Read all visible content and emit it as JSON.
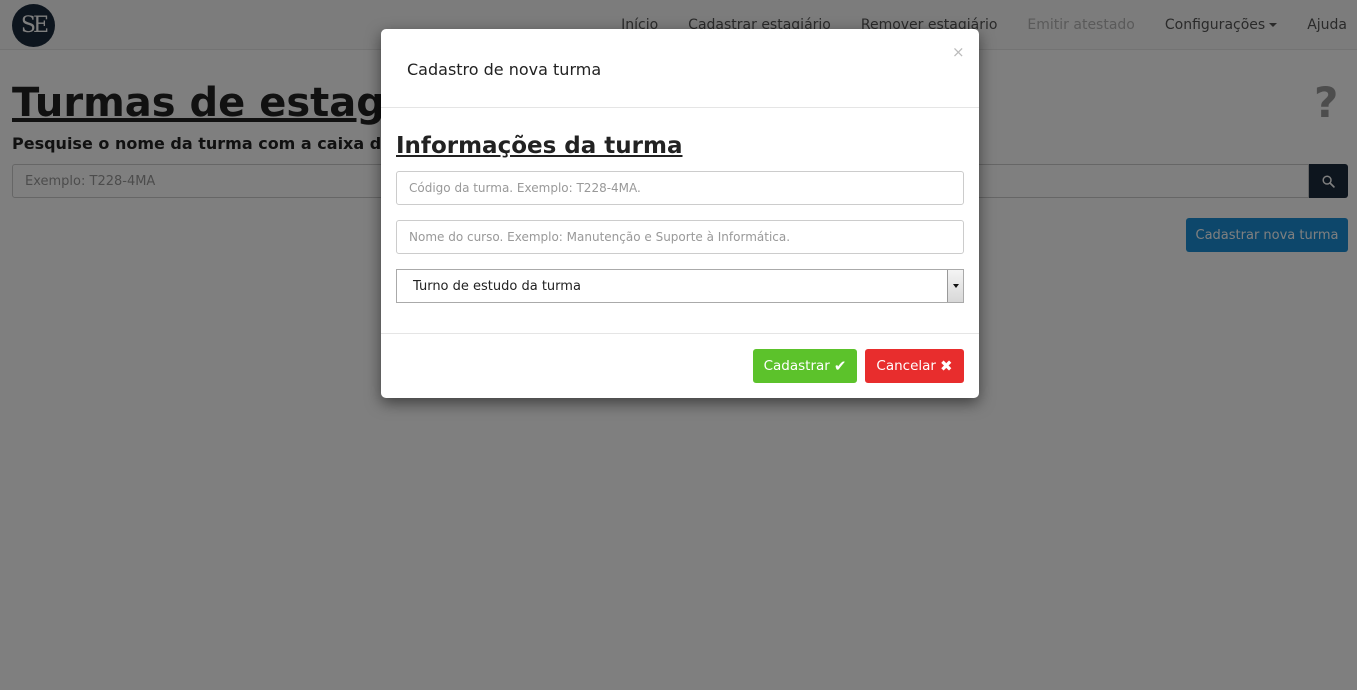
{
  "app": {
    "logo_text": "SE"
  },
  "nav": {
    "items": [
      {
        "label": "Início"
      },
      {
        "label": "Cadastrar estagiário"
      },
      {
        "label": "Remover estagiário"
      },
      {
        "label": "Emitir atestado",
        "disabled": true
      },
      {
        "label": "Configurações",
        "dropdown": true
      },
      {
        "label": "Ajuda"
      }
    ]
  },
  "page": {
    "title": "Turmas de estagiários",
    "subtitle": "Pesquise o nome da turma com a caixa de pesquisa",
    "help_symbol": "?",
    "search": {
      "placeholder": "Exemplo: T228-4MA",
      "value": ""
    },
    "new_class_button": "Cadastrar nova turma"
  },
  "modal": {
    "title": "Cadastro de nova turma",
    "close_symbol": "×",
    "section_title": "Informações da turma",
    "code_field": {
      "placeholder": "Código da turma. Exemplo: T228-4MA.",
      "value": ""
    },
    "course_field": {
      "placeholder": "Nome do curso. Exemplo: Manutenção e Suporte à Informática.",
      "value": ""
    },
    "shift_select": {
      "selected": "Turno de estudo da turma"
    },
    "submit_label": "Cadastrar",
    "submit_icon": "✔",
    "cancel_label": "Cancelar",
    "cancel_icon": "✖"
  },
  "colors": {
    "navy": "#1b2a3c",
    "primary_button": "#1a8fd6",
    "submit_button": "#5cc22b",
    "cancel_button": "#e82d2d"
  }
}
